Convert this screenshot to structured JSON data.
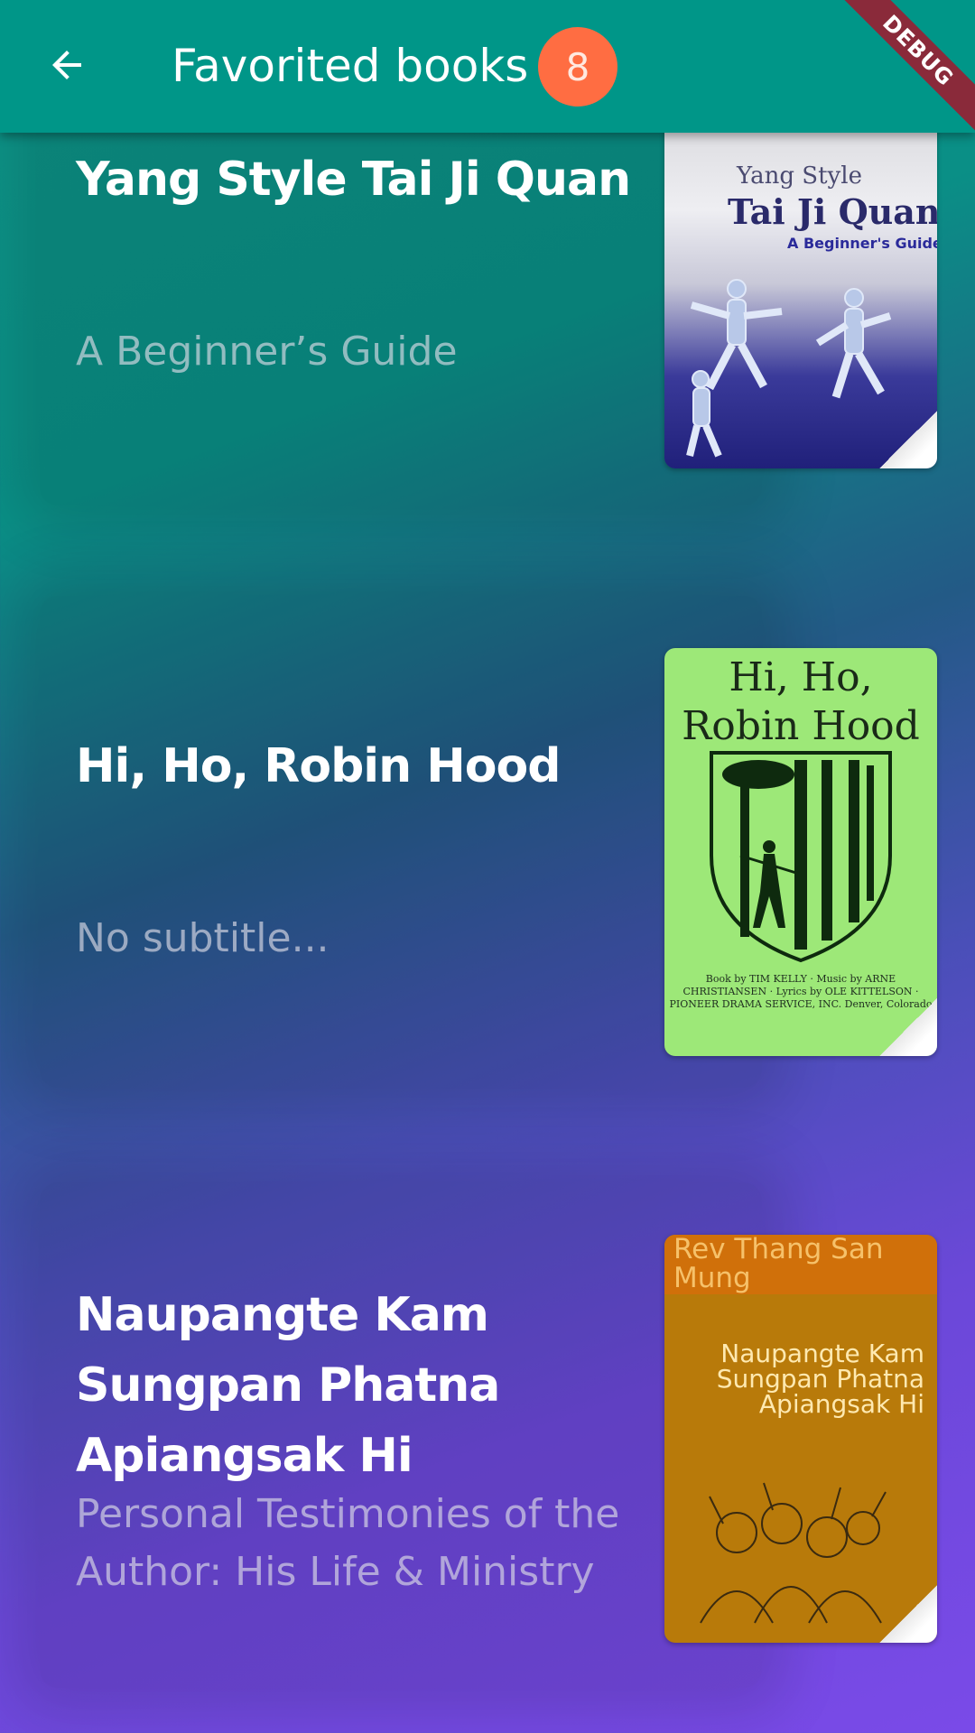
{
  "appbar": {
    "title": "Favorited books",
    "count": "8",
    "debug_label": "DEBUG"
  },
  "books": [
    {
      "title": "Yang Style Tai Ji Quan",
      "subtitle": "A Beginner’s Guide",
      "cover": {
        "line1": "Yang Style",
        "line2": "Tai Ji Quan:",
        "line3": "A Beginner's Guide"
      }
    },
    {
      "title": "Hi, Ho, Robin Hood",
      "subtitle": "No subtitle...",
      "cover": {
        "title": "Hi, Ho, Robin Hood",
        "credits": "Book by TIM KELLY · Music by ARNE CHRISTIANSEN · Lyrics by OLE KITTELSON · PIONEER DRAMA SERVICE, INC. Denver, Colorado"
      }
    },
    {
      "title": "Naupangte Kam Sungpan Phatna Apiangsak Hi",
      "subtitle": "Personal Testimonies of the Author: His Life & Ministry",
      "cover": {
        "author": "Rev Thang San Mung",
        "title": "Naupangte Kam Sungpan Phatna Apiangsak Hi"
      }
    }
  ],
  "colors": {
    "appbar": "#009688",
    "badge": "#ff6d42"
  }
}
